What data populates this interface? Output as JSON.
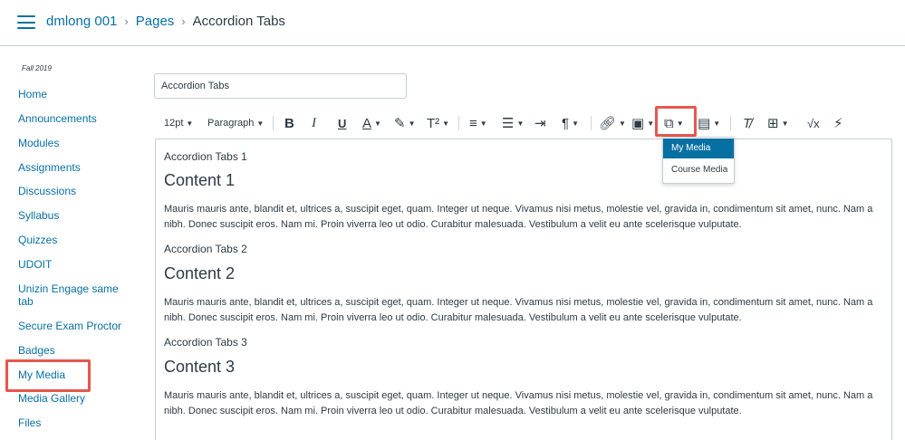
{
  "header": {
    "breadcrumbs": [
      "dmlong 001",
      "Pages",
      "Accordion Tabs"
    ]
  },
  "sidebar": {
    "term": "Fall 2019",
    "items": [
      {
        "label": "Home"
      },
      {
        "label": "Announcements"
      },
      {
        "label": "Modules"
      },
      {
        "label": "Assignments"
      },
      {
        "label": "Discussions"
      },
      {
        "label": "Syllabus"
      },
      {
        "label": "Quizzes"
      },
      {
        "label": "UDOIT"
      },
      {
        "label": "Unizin Engage same tab"
      },
      {
        "label": "Secure Exam Proctor"
      },
      {
        "label": "Badges"
      },
      {
        "label": "My Media"
      },
      {
        "label": "Media Gallery"
      },
      {
        "label": "Files"
      }
    ]
  },
  "editor": {
    "title_value": "Accordion Tabs",
    "toolbar": {
      "font_size": "12pt",
      "block_format": "Paragraph",
      "superscript": "T²"
    },
    "media_menu": {
      "items": [
        "My Media",
        "Course Media"
      ],
      "selected": "My Media"
    },
    "sections": [
      {
        "label": "Accordion Tabs 1",
        "heading": "Content 1",
        "body": "Mauris mauris ante, blandit et, ultrices a, suscipit eget, quam. Integer ut neque. Vivamus nisi metus, molestie vel, gravida in, condimentum sit amet, nunc. Nam a nibh. Donec suscipit eros. Nam mi. Proin viverra leo ut odio. Curabitur malesuada. Vestibulum a velit eu ante scelerisque vulputate."
      },
      {
        "label": "Accordion Tabs 2",
        "heading": "Content 2",
        "body": "Mauris mauris ante, blandit et, ultrices a, suscipit eget, quam. Integer ut neque. Vivamus nisi metus, molestie vel, gravida in, condimentum sit amet, nunc. Nam a nibh. Donec suscipit eros. Nam mi. Proin viverra leo ut odio. Curabitur malesuada. Vestibulum a velit eu ante scelerisque vulputate."
      },
      {
        "label": "Accordion Tabs 3",
        "heading": "Content 3",
        "body": "Mauris mauris ante, blandit et, ultrices a, suscipit eget, quam. Integer ut neque. Vivamus nisi metus, molestie vel, gravida in, condimentum sit amet, nunc. Nam a nibh. Donec suscipit eros. Nam mi. Proin viverra leo ut odio. Curabitur malesuada. Vestibulum a velit eu ante scelerisque vulputate."
      }
    ]
  },
  "colors": {
    "link": "#0770a3",
    "text": "#2d3b45",
    "highlight": "#e5574f",
    "menu_selected": "#0770a3"
  }
}
